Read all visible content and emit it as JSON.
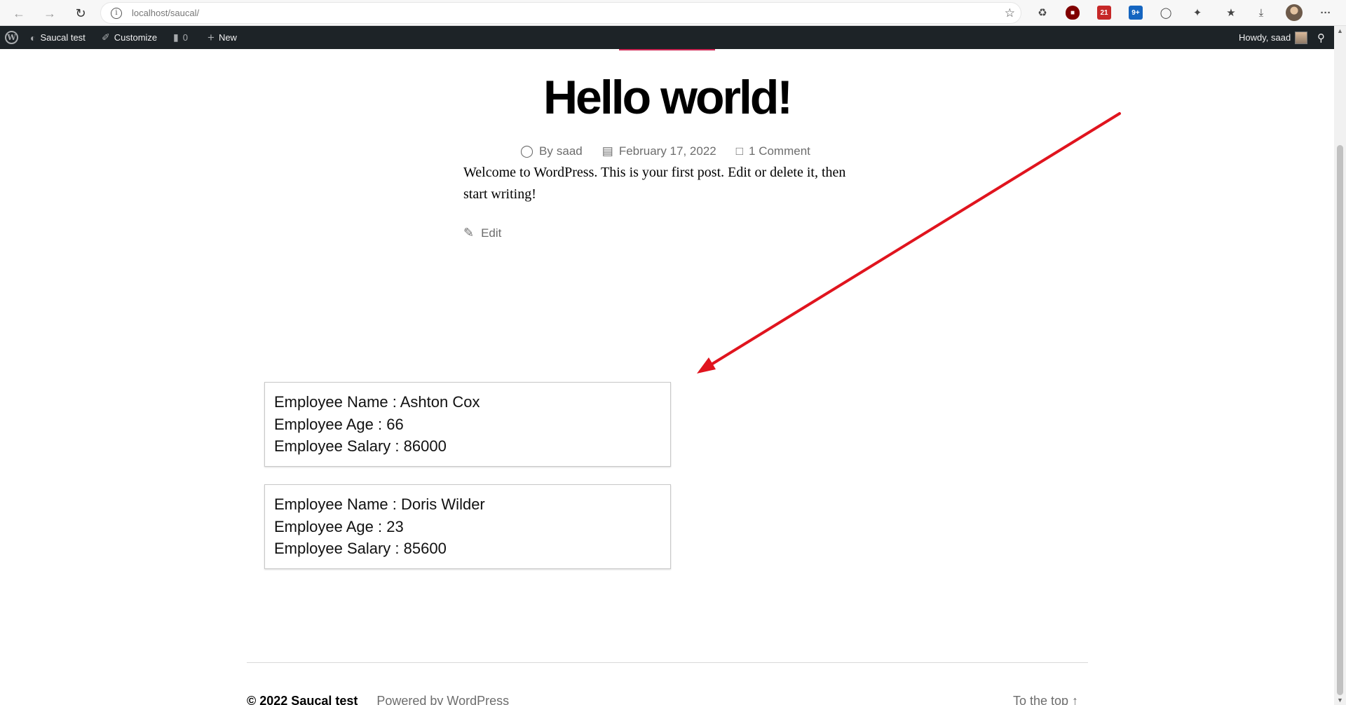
{
  "browser": {
    "url_host": "localhost",
    "url_path": "/saucal/",
    "extension_badges": [
      "21",
      "9+"
    ]
  },
  "admin_bar": {
    "site_name": "Saucal test",
    "customize": "Customize",
    "comments_count": "0",
    "new_label": "New",
    "howdy": "Howdy, saad"
  },
  "post": {
    "title": "Hello world!",
    "author_prefix": "By",
    "author": "saad",
    "date": "February 17, 2022",
    "comments": "1 Comment",
    "content": "Welcome to WordPress. This is your first post. Edit or delete it, then start writing!",
    "edit_label": "Edit"
  },
  "employees": [
    {
      "name_line": "Employee Name : Ashton Cox",
      "age_line": "Employee Age : 66",
      "salary_line": "Employee Salary : 86000"
    },
    {
      "name_line": "Employee Name : Doris Wilder",
      "age_line": "Employee Age : 23",
      "salary_line": "Employee Salary : 85600"
    }
  ],
  "footer": {
    "copyright": "© 2022 Saucal test",
    "powered_by": "Powered by WordPress",
    "to_top": "To the top ↑"
  },
  "colors": {
    "admin_bar_bg": "#1d2327",
    "accent": "#cd2653",
    "annotation_arrow": "#e0141e",
    "meta_text": "#6d6d6d"
  }
}
